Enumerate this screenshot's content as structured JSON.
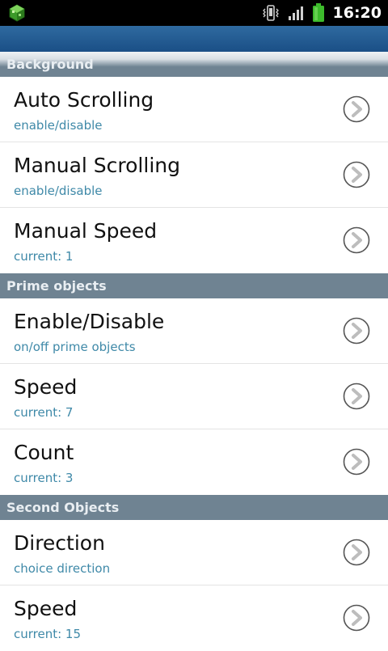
{
  "status_bar": {
    "time": "16:20"
  },
  "sections": [
    {
      "header": "Background",
      "items": [
        {
          "title": "Auto Scrolling",
          "summary": "enable/disable"
        },
        {
          "title": "Manual Scrolling",
          "summary": "enable/disable"
        },
        {
          "title": "Manual Speed",
          "summary": "current: 1"
        }
      ]
    },
    {
      "header": "Prime objects",
      "items": [
        {
          "title": "Enable/Disable",
          "summary": "on/off prime objects"
        },
        {
          "title": "Speed",
          "summary": "current: 7"
        },
        {
          "title": "Count",
          "summary": "current: 3"
        }
      ]
    },
    {
      "header": "Second Objects",
      "items": [
        {
          "title": "Direction",
          "summary": "choice direction"
        },
        {
          "title": "Speed",
          "summary": "current: 15"
        }
      ]
    }
  ],
  "icons": {
    "app": "app-cube-icon",
    "vibrate": "vibrate-icon",
    "signal": "signal-icon",
    "battery": "battery-icon",
    "chevron": "chevron-right-circle-icon"
  },
  "colors": {
    "title_bar": "#1a4f86",
    "section_header": "#6f8392",
    "summary_text": "#3f89a8",
    "battery": "#3dbb2c"
  }
}
